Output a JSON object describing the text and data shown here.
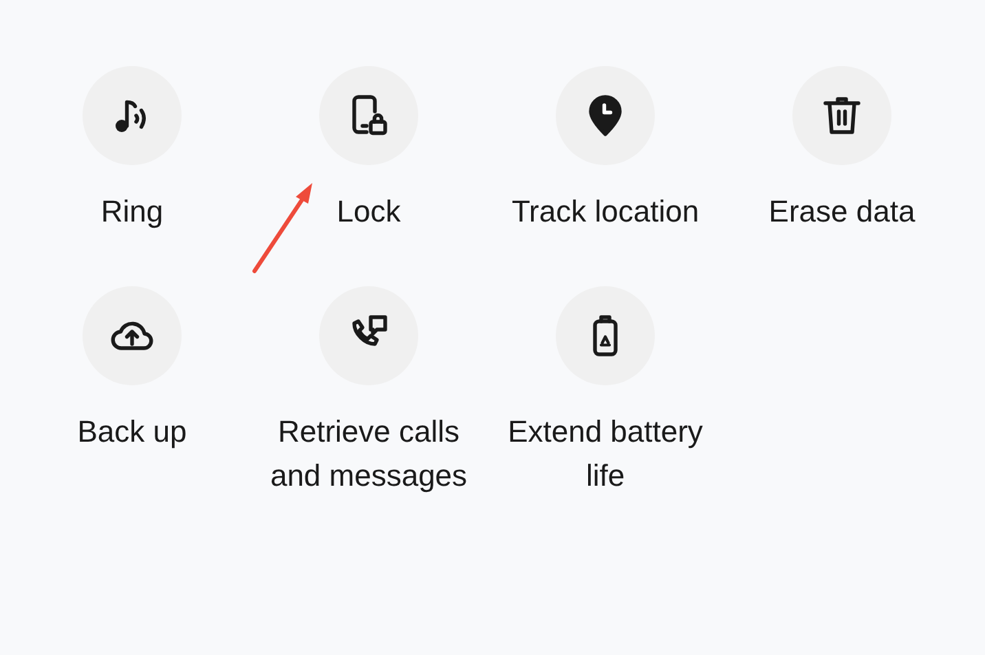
{
  "actions": [
    {
      "label": "Ring"
    },
    {
      "label": "Lock"
    },
    {
      "label": "Track location"
    },
    {
      "label": "Erase data"
    },
    {
      "label": "Back up"
    },
    {
      "label": "Retrieve calls and messages"
    },
    {
      "label": "Extend battery life"
    }
  ]
}
